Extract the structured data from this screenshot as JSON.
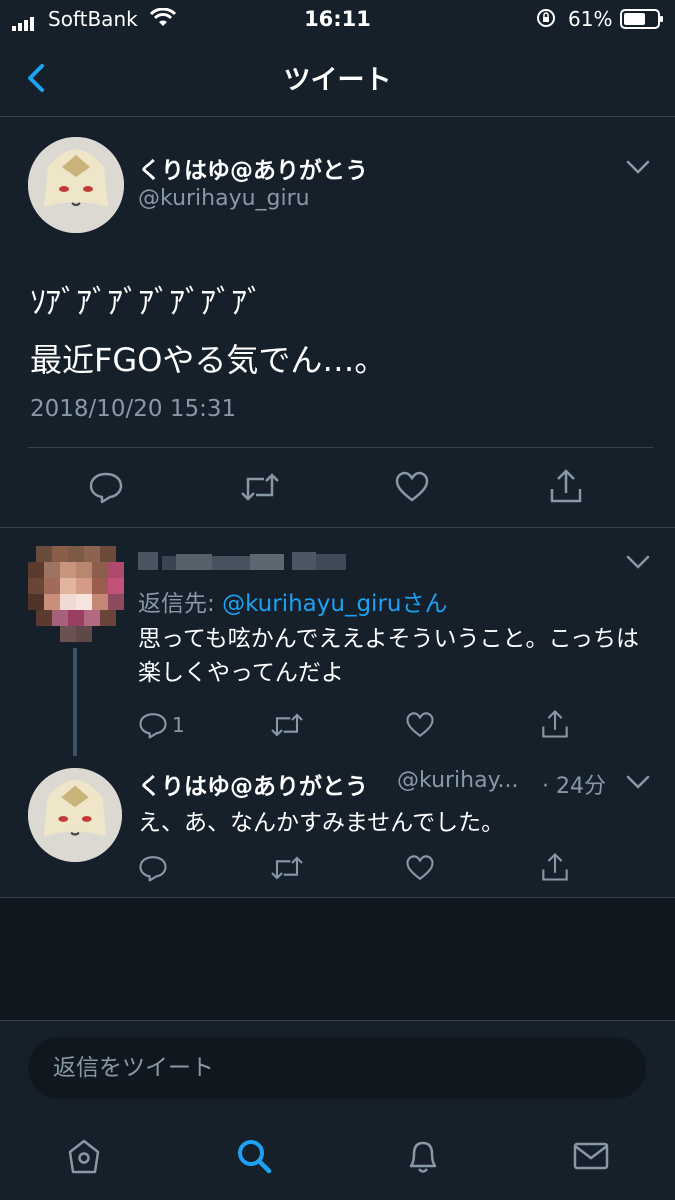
{
  "status_bar": {
    "carrier": "SoftBank",
    "time": "16:11",
    "battery": "61%"
  },
  "header": {
    "title": "ツイート"
  },
  "main_tweet": {
    "name": "くりはゆ@ありがとう",
    "handle": "@kurihayu_giru",
    "text_line1": "ｿｱﾞｱﾞｱﾞｱﾞｱﾞｱﾞｱﾞ",
    "text_line2": "最近FGOやる気でん…。",
    "timestamp": "2018/10/20 15:31"
  },
  "reply1": {
    "replying_to_prefix": "返信先: ",
    "replying_to_handle": "@kurihayu_giru",
    "replying_to_suffix": "さん",
    "text": "思っても呟かんでええよそういうこと。こっちは楽しくやってんだよ",
    "reply_count": "1"
  },
  "reply2": {
    "name": "くりはゆ@ありがとう",
    "handle": "@kurihay...",
    "time": "· 24分",
    "text": "え、あ、なんかすみませんでした。"
  },
  "reply_box": {
    "placeholder": "返信をツイート"
  },
  "colors": {
    "background": "#15202b",
    "accent": "#1da1f2",
    "muted": "#8899a6",
    "divider": "#38444d"
  }
}
